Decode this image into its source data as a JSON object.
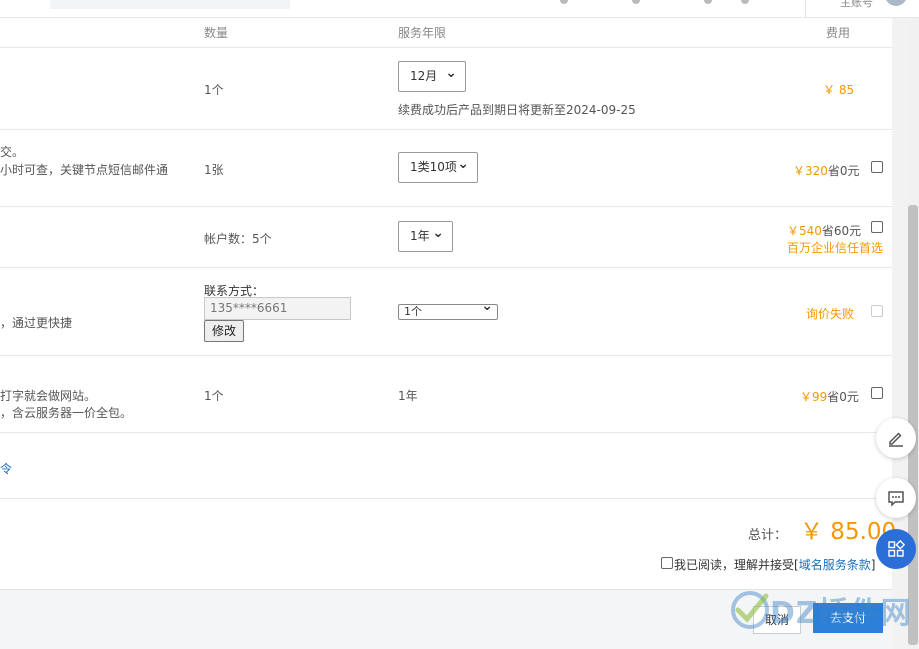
{
  "header": {
    "user_label": "主账号"
  },
  "table": {
    "col_quantity": "数量",
    "col_period": "服务年限",
    "col_fee": "费用"
  },
  "rows": {
    "domain": {
      "quantity": "1个",
      "period_select": "12月",
      "renew_note": "续费成功后产品到期日将更新至2024-09-25",
      "price": "￥ 85"
    },
    "sms": {
      "desc_line1": "交。",
      "desc_line2": "小时可查，关键节点短信邮件通",
      "quantity": "1张",
      "period_select": "1类10项",
      "price": "￥320",
      "save": "省0元"
    },
    "email": {
      "quantity": "帐户数：5个",
      "period_select": "1年",
      "price": "￥540",
      "save": "省60元",
      "promo": "百万企业信任首选"
    },
    "contact": {
      "desc": "，通过更快捷",
      "contact_label": "联系方式：",
      "phone_value": "135****6661",
      "edit_label": "修改",
      "count_select": "1个",
      "status": "询价失败"
    },
    "website": {
      "desc_line1": "打字就会做网站。",
      "desc_line2": "，含云服务器一价全包。",
      "quantity": "1个",
      "period": "1年",
      "price": "￥99",
      "save": "省0元"
    }
  },
  "coupon": {
    "link_fragment": "令"
  },
  "summary": {
    "total_label": "总计：",
    "total_value": "￥ 85.00",
    "agree_text": "我已阅读，理解并接受[",
    "terms_link": "域名服务条款",
    "agree_close": "]"
  },
  "footer": {
    "cancel_label": "取消",
    "pay_label": "去支付"
  },
  "watermark": {
    "text": "DZ插件网"
  },
  "colors": {
    "accent_orange": "#f39800",
    "primary_blue": "#2c80d8",
    "link_blue": "#1a6fb8"
  },
  "icons": [
    "edit-icon",
    "chat-icon",
    "apps-icon"
  ]
}
